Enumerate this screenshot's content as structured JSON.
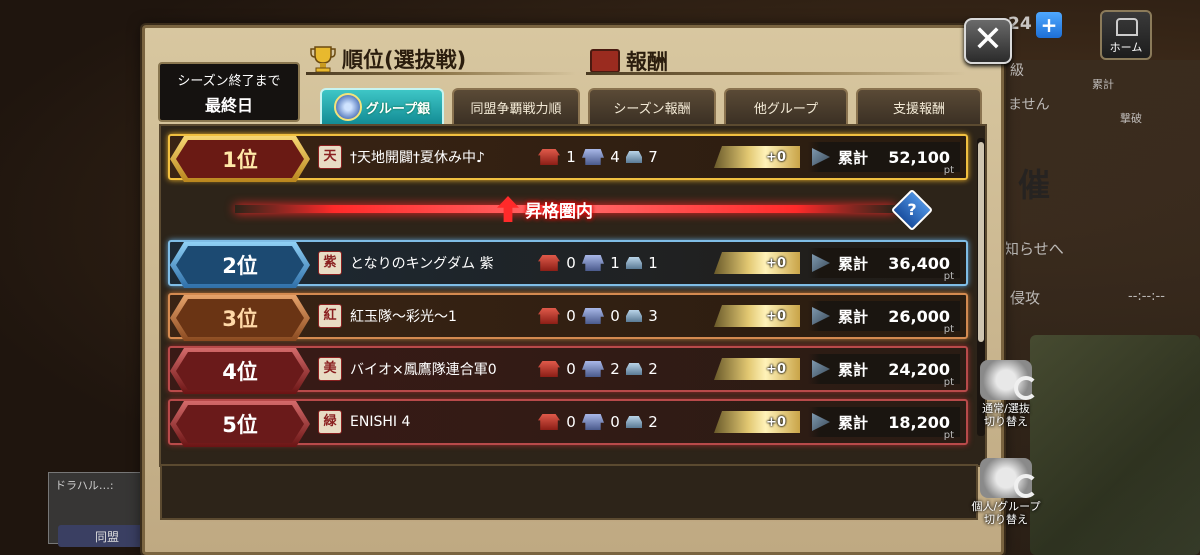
{
  "background": {
    "right_texts": [
      "級",
      "ません",
      "累計",
      "撃破",
      "催",
      "知らせへ",
      "侵攻",
      "--:--:--"
    ],
    "left_panel_text": "ドラハル…:",
    "alliance_button": "同盟",
    "home_label": "ホーム",
    "stamina_count": "24"
  },
  "header": {
    "ranking_title": "順位(選抜戦)",
    "reward_title": "報酬",
    "season_label": "シーズン終了まで",
    "season_value": "最終日"
  },
  "tabs": [
    {
      "label": "グループ銀",
      "active": true
    },
    {
      "label": "同盟争覇戦力順",
      "active": false
    },
    {
      "label": "シーズン報酬",
      "active": false
    },
    {
      "label": "他グループ",
      "active": false
    },
    {
      "label": "支援報酬",
      "active": false
    }
  ],
  "promotion_zone_label": "昇格圏内",
  "help_label": "?",
  "total_label": "累計",
  "pt_unit": "pt",
  "rows": [
    {
      "rank": "1位",
      "icon": "天",
      "name": "†天地開闢†夏休み中♪",
      "big": "1",
      "mid": "4",
      "small": "7",
      "pt": "+0",
      "total": "52,100",
      "tier": "gold"
    },
    {
      "rank": "2位",
      "icon": "紫",
      "name": "となりのキングダム 紫",
      "big": "0",
      "mid": "1",
      "small": "1",
      "pt": "+0",
      "total": "36,400",
      "tier": "blue"
    },
    {
      "rank": "3位",
      "icon": "紅",
      "name": "紅玉隊〜彩光〜1",
      "big": "0",
      "mid": "0",
      "small": "3",
      "pt": "+0",
      "total": "26,000",
      "tier": "bronze"
    },
    {
      "rank": "4位",
      "icon": "美",
      "name": "バイオ×鳳鷹隊連合軍0",
      "big": "0",
      "mid": "2",
      "small": "2",
      "pt": "+0",
      "total": "24,200",
      "tier": "red"
    },
    {
      "rank": "5位",
      "icon": "緑",
      "name": "ENISHI 4",
      "big": "0",
      "mid": "0",
      "small": "2",
      "pt": "+0",
      "total": "18,200",
      "tier": "red"
    }
  ],
  "my_row": {
    "rank": "5位",
    "icon": "緑",
    "name": "ENISHI 4",
    "big": "0",
    "mid": "0",
    "small": "2",
    "pt": "+0",
    "total": "18,200",
    "tier": "red"
  },
  "side_buttons": {
    "switch_mode": "通常/選抜\n切り替え",
    "switch_group": "個人/グループ\n切り替え"
  },
  "colors": {
    "gold": "#e7b93a",
    "blue": "#5fa3d6",
    "bronze": "#c2783e",
    "red": "#9c2a2a",
    "tab_active": "#1fa8ad"
  }
}
